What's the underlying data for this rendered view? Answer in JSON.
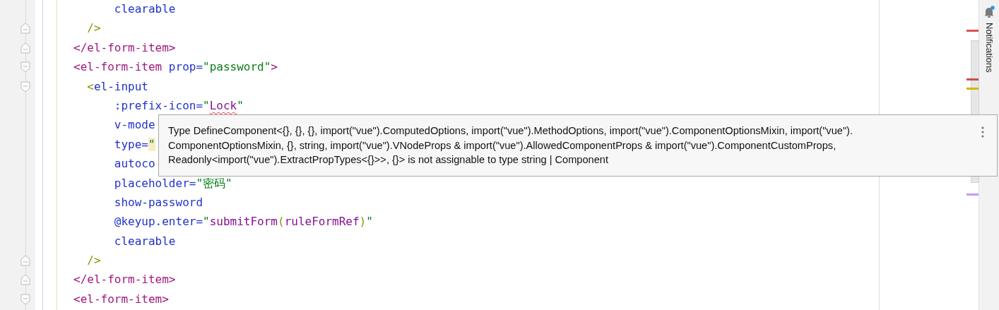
{
  "editor": {
    "lines": [
      {
        "kind": "plain",
        "tokens": [
          {
            "kind": "attr",
            "text": "      clearable"
          }
        ]
      },
      {
        "kind": "closer",
        "tokens": [
          {
            "kind": "punct",
            "text": "  />"
          }
        ]
      },
      {
        "kind": "closer",
        "tokens": [
          {
            "kind": "tag",
            "text": "</el-form-item>"
          }
        ]
      },
      {
        "kind": "opener",
        "tokens": [
          {
            "kind": "tag",
            "text": "<el-form-item"
          },
          {
            "kind": "attr",
            "text": " prop="
          },
          {
            "kind": "string",
            "text": "\"password\""
          },
          {
            "kind": "tag",
            "text": ">"
          }
        ]
      },
      {
        "kind": "opener",
        "tokens": [
          {
            "kind": "punct",
            "text": "  <"
          },
          {
            "kind": "attr",
            "text": "el-input"
          }
        ]
      },
      {
        "kind": "plain",
        "tokens": [
          {
            "kind": "attr",
            "text": "      :prefix-icon="
          },
          {
            "kind": "string",
            "text": "\""
          },
          {
            "kind": "error",
            "text": "Lock"
          },
          {
            "kind": "string",
            "text": "\""
          }
        ]
      },
      {
        "kind": "plain",
        "tokens": [
          {
            "kind": "attr",
            "text": "      v-mode"
          }
        ]
      },
      {
        "kind": "plain",
        "tokens": [
          {
            "kind": "attr",
            "text": "      type="
          },
          {
            "kind": "highlight",
            "text": "\""
          }
        ]
      },
      {
        "kind": "plain",
        "tokens": [
          {
            "kind": "attr",
            "text": "      autoco"
          }
        ]
      },
      {
        "kind": "plain",
        "tokens": [
          {
            "kind": "attr",
            "text": "      placeholder="
          },
          {
            "kind": "string",
            "text": "\"密码\""
          }
        ]
      },
      {
        "kind": "plain",
        "tokens": [
          {
            "kind": "attr",
            "text": "      show-password"
          }
        ]
      },
      {
        "kind": "plain",
        "tokens": [
          {
            "kind": "attr",
            "text": "      @keyup.enter="
          },
          {
            "kind": "string",
            "text": "\""
          },
          {
            "kind": "value",
            "text": "submitForm"
          },
          {
            "kind": "punct",
            "text": "("
          },
          {
            "kind": "value",
            "text": "ruleFormRef"
          },
          {
            "kind": "punct",
            "text": ")"
          },
          {
            "kind": "string",
            "text": "\""
          }
        ]
      },
      {
        "kind": "plain",
        "tokens": [
          {
            "kind": "attr",
            "text": "      clearable"
          }
        ]
      },
      {
        "kind": "closer",
        "tokens": [
          {
            "kind": "punct",
            "text": "  />"
          }
        ]
      },
      {
        "kind": "closer",
        "tokens": [
          {
            "kind": "tag",
            "text": "</el-form-item>"
          }
        ]
      },
      {
        "kind": "opener",
        "tokens": [
          {
            "kind": "tag",
            "text": "<el-form-item>"
          }
        ]
      }
    ]
  },
  "tooltip": {
    "lines": [
      "Type DefineComponent<{}, {}, {}, import(\"vue\").ComputedOptions, import(\"vue\").MethodOptions, import(\"vue\").ComponentOptionsMixin, import(\"vue\").",
      "ComponentOptionsMixin, {}, string, import(\"vue\").VNodeProps & import(\"vue\").AllowedComponentProps & import(\"vue\").ComponentCustomProps,",
      "Readonly<import(\"vue\").ExtractPropTypes<{}>>, {}> is not assignable to type string | Component"
    ]
  },
  "scrollbar": {
    "marks": [
      {
        "color": "#d9534f"
      },
      {
        "color": "#c9504a"
      },
      {
        "color": "#d6b600"
      },
      {
        "color": "#c49bf2"
      }
    ]
  },
  "side_panel": {
    "label": "Notifications",
    "has_unread": true
  }
}
